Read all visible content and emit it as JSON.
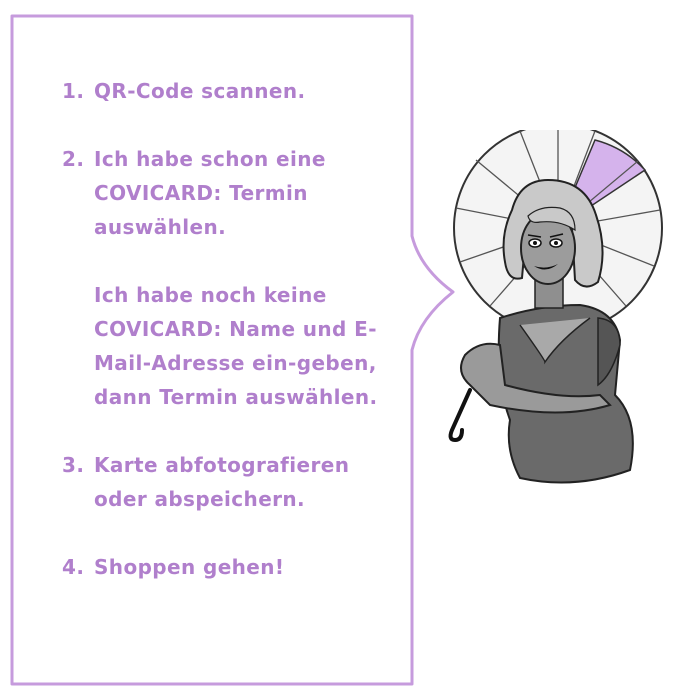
{
  "steps": [
    {
      "number": "1.",
      "text": [
        "QR-Code scannen."
      ]
    },
    {
      "number": "2.",
      "text": [
        "Ich habe schon eine COVICARD: Termin auswählen.",
        "Ich habe noch keine COVICARD: Name und E-Mail-Adresse ein-geben, dann Termin auswählen."
      ]
    },
    {
      "number": "3.",
      "text": [
        "Karte abfotografieren oder abspeichern."
      ]
    },
    {
      "number": "4.",
      "text": [
        "Shoppen gehen!"
      ]
    }
  ],
  "colors": {
    "accent": "#b07fcc",
    "bubble_border": "#c69bdd",
    "umbrella_panel": "#d5b3ec"
  },
  "illustration": "woman-with-parasol"
}
